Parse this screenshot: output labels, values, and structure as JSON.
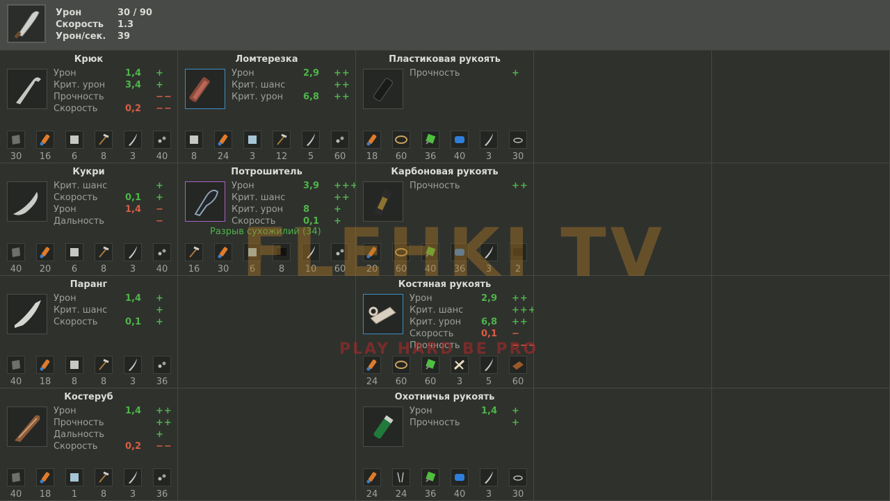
{
  "header": {
    "weapon_icon": "machete-icon",
    "stats": [
      {
        "label": "Урон",
        "value": "30 / 90"
      },
      {
        "label": "Скорость",
        "value": "1.3"
      },
      {
        "label": "Урон/сек.",
        "value": "39"
      }
    ]
  },
  "watermark": {
    "logo": "FLEHKI TV",
    "tagline": "PLAY HARD BE PRO"
  },
  "cells": [
    {
      "col": 0,
      "row": 0,
      "title": "Крюк",
      "icon": "hook-blade-icon",
      "frame": "",
      "stats": [
        {
          "name": "Урон",
          "val": "1,4",
          "mod": "+",
          "c": "g"
        },
        {
          "name": "Крит. урон",
          "val": "3,4",
          "mod": "+",
          "c": "g"
        },
        {
          "name": "Прочность",
          "val": "",
          "mod": "−−",
          "c": "r"
        },
        {
          "name": "Скорость",
          "val": "0,2",
          "mod": "−−",
          "c": "r"
        }
      ],
      "mats": [
        [
          "metal-plate-icon",
          "30"
        ],
        [
          "glue-icon",
          "16"
        ],
        [
          "metal-sheet-icon",
          "6"
        ],
        [
          "hammer-icon",
          "8"
        ],
        [
          "blade-icon",
          "3"
        ],
        [
          "bolts-icon",
          "40"
        ]
      ]
    },
    {
      "col": 1,
      "row": 0,
      "title": "Ломтерезка",
      "icon": "chainsaw-blade-icon",
      "frame": "blue",
      "stats": [
        {
          "name": "Урон",
          "val": "2,9",
          "mod": "++",
          "c": "g"
        },
        {
          "name": "Крит. шанс",
          "val": "",
          "mod": "++",
          "c": "g"
        },
        {
          "name": "Крит. урон",
          "val": "6,8",
          "mod": "++",
          "c": "g"
        }
      ],
      "mats": [
        [
          "metal-sheet-icon",
          "8"
        ],
        [
          "glue-icon",
          "24"
        ],
        [
          "glass-icon",
          "3"
        ],
        [
          "hammer-icon",
          "12"
        ],
        [
          "blade-icon",
          "5"
        ],
        [
          "bolts-icon",
          "60"
        ]
      ]
    },
    {
      "col": 2,
      "row": 0,
      "title": "Пластиковая рукоять",
      "icon": "plastic-handle-icon",
      "frame": "",
      "stats": [
        {
          "name": "Прочность",
          "val": "",
          "mod": "+",
          "c": "g"
        }
      ],
      "mats": [
        [
          "glue-icon",
          "18"
        ],
        [
          "rope-icon",
          "60"
        ],
        [
          "green-chip-icon",
          "36"
        ],
        [
          "blue-tape-icon",
          "40"
        ],
        [
          "blade-icon",
          "3"
        ],
        [
          "wire-icon",
          "30"
        ]
      ]
    },
    {
      "col": 0,
      "row": 1,
      "title": "Кукри",
      "icon": "kukri-icon",
      "frame": "",
      "stats": [
        {
          "name": "Крит. шанс",
          "val": "",
          "mod": "+",
          "c": "g"
        },
        {
          "name": "Скорость",
          "val": "0,1",
          "mod": "+",
          "c": "g"
        },
        {
          "name": "Урон",
          "val": "1,4",
          "mod": "−",
          "c": "r"
        },
        {
          "name": "Дальность",
          "val": "",
          "mod": "−",
          "c": "r"
        }
      ],
      "mats": [
        [
          "metal-plate-icon",
          "40"
        ],
        [
          "glue-icon",
          "20"
        ],
        [
          "metal-sheet-icon",
          "6"
        ],
        [
          "hammer-icon",
          "8"
        ],
        [
          "blade-icon",
          "3"
        ],
        [
          "bolts-icon",
          "40"
        ]
      ]
    },
    {
      "col": 1,
      "row": 1,
      "title": "Потрошитель",
      "icon": "gutter-blade-icon",
      "frame": "purple",
      "special": "Разрыв сухожилий (34)",
      "stats": [
        {
          "name": "Урон",
          "val": "3,9",
          "mod": "+++",
          "c": "g"
        },
        {
          "name": "Крит. шанс",
          "val": "",
          "mod": "++",
          "c": "g"
        },
        {
          "name": "Крит. урон",
          "val": "8",
          "mod": "+",
          "c": "g"
        },
        {
          "name": "Скорость",
          "val": "0,1",
          "mod": "+",
          "c": "g"
        }
      ],
      "mats": [
        [
          "hammer-icon",
          "16"
        ],
        [
          "glue-icon",
          "30"
        ],
        [
          "glass-icon",
          "6"
        ],
        [
          "black-plate-icon",
          "8"
        ],
        [
          "blade-icon",
          "10"
        ],
        [
          "bolts-icon",
          "60"
        ]
      ]
    },
    {
      "col": 2,
      "row": 1,
      "title": "Карбоновая рукоять",
      "icon": "carbon-handle-icon",
      "frame": "",
      "stats": [
        {
          "name": "Прочность",
          "val": "",
          "mod": "++",
          "c": "g"
        }
      ],
      "mats": [
        [
          "glue-icon",
          "20"
        ],
        [
          "rope-icon",
          "60"
        ],
        [
          "green-chip-icon",
          "40"
        ],
        [
          "blue-tape-icon",
          "36"
        ],
        [
          "blade-icon",
          "3"
        ],
        [
          "black-plate-icon",
          "2"
        ]
      ]
    },
    {
      "col": 0,
      "row": 2,
      "title": "Паранг",
      "icon": "parang-icon",
      "frame": "",
      "stats": [
        {
          "name": "Урон",
          "val": "1,4",
          "mod": "+",
          "c": "g"
        },
        {
          "name": "Крит. шанс",
          "val": "",
          "mod": "+",
          "c": "g"
        },
        {
          "name": "Скорость",
          "val": "0,1",
          "mod": "+",
          "c": "g"
        }
      ],
      "mats": [
        [
          "metal-plate-icon",
          "40"
        ],
        [
          "glue-icon",
          "18"
        ],
        [
          "metal-sheet-icon",
          "8"
        ],
        [
          "hammer-icon",
          "8"
        ],
        [
          "blade-icon",
          "3"
        ],
        [
          "bolts-icon",
          "36"
        ]
      ]
    },
    {
      "col": 2,
      "row": 2,
      "title": "Костяная рукоять",
      "icon": "bone-handle-icon",
      "frame": "blue",
      "stats": [
        {
          "name": "Урон",
          "val": "2,9",
          "mod": "++",
          "c": "g"
        },
        {
          "name": "Крит. шанс",
          "val": "",
          "mod": "+++",
          "c": "g"
        },
        {
          "name": "Крит. урон",
          "val": "6,8",
          "mod": "++",
          "c": "g"
        },
        {
          "name": "Скорость",
          "val": "0,1",
          "mod": "−",
          "c": "r"
        },
        {
          "name": "Прочность",
          "val": "",
          "mod": "−−−",
          "c": "r"
        }
      ],
      "mats": [
        [
          "glue-icon",
          "24"
        ],
        [
          "rope-icon",
          "60"
        ],
        [
          "green-chip-icon",
          "60"
        ],
        [
          "bones-icon",
          "3"
        ],
        [
          "blade-icon",
          "5"
        ],
        [
          "leather-icon",
          "60"
        ]
      ]
    },
    {
      "col": 0,
      "row": 3,
      "title": "Костеруб",
      "icon": "bone-cleaver-icon",
      "frame": "",
      "stats": [
        {
          "name": "Урон",
          "val": "1,4",
          "mod": "++",
          "c": "g"
        },
        {
          "name": "Прочность",
          "val": "",
          "mod": "++",
          "c": "g"
        },
        {
          "name": "Дальность",
          "val": "",
          "mod": "+",
          "c": "g"
        },
        {
          "name": "Скорость",
          "val": "0,2",
          "mod": "−−",
          "c": "r"
        }
      ],
      "mats": [
        [
          "metal-plate-icon",
          "40"
        ],
        [
          "glue-icon",
          "18"
        ],
        [
          "glass-icon",
          "1"
        ],
        [
          "hammer-icon",
          "8"
        ],
        [
          "blade-icon",
          "3"
        ],
        [
          "bolts-icon",
          "36"
        ]
      ]
    },
    {
      "col": 2,
      "row": 3,
      "title": "Охотничья рукоять",
      "icon": "hunter-handle-icon",
      "frame": "",
      "stats": [
        {
          "name": "Урон",
          "val": "1,4",
          "mod": "+",
          "c": "g"
        },
        {
          "name": "Прочность",
          "val": "",
          "mod": "+",
          "c": "g"
        }
      ],
      "mats": [
        [
          "glue-icon",
          "24"
        ],
        [
          "nails-icon",
          "24"
        ],
        [
          "green-chip-icon",
          "36"
        ],
        [
          "blue-tape-icon",
          "40"
        ],
        [
          "blade-icon",
          "3"
        ],
        [
          "wire-icon",
          "30"
        ]
      ]
    }
  ]
}
